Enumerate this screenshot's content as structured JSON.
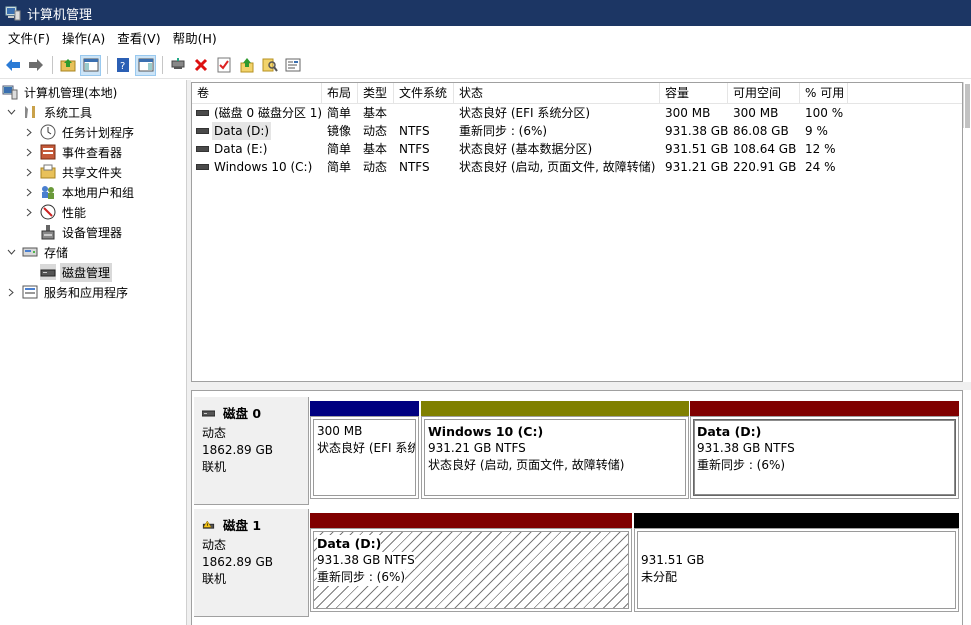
{
  "window": {
    "title": "计算机管理"
  },
  "menu": [
    "文件(F)",
    "操作(A)",
    "查看(V)",
    "帮助(H)"
  ],
  "toolbar": {
    "buttons": [
      "back-icon",
      "forward-icon",
      "up-folder-icon",
      "show-hide-tree-icon",
      "help-icon",
      "action-pane-icon",
      "connect-icon",
      "delete-icon",
      "properties-icon",
      "export-icon",
      "find-icon",
      "settings-icon"
    ]
  },
  "tree": {
    "root": "计算机管理(本地)",
    "system_tools": "系统工具",
    "task_scheduler": "任务计划程序",
    "event_viewer": "事件查看器",
    "shared_folders": "共享文件夹",
    "local_users": "本地用户和组",
    "performance": "性能",
    "device_manager": "设备管理器",
    "storage": "存储",
    "disk_management": "磁盘管理",
    "services": "服务和应用程序"
  },
  "volumes": {
    "headers": [
      "卷",
      "布局",
      "类型",
      "文件系统",
      "状态",
      "容量",
      "可用空间",
      "% 可用"
    ],
    "rows": [
      [
        "(磁盘 0 磁盘分区 1)",
        "简单",
        "基本",
        "",
        "状态良好 (EFI 系统分区)",
        "300 MB",
        "300 MB",
        "100 %"
      ],
      [
        "Data (D:)",
        "镜像",
        "动态",
        "NTFS",
        "重新同步 : (6%)",
        "931.38 GB",
        "86.08 GB",
        "9 %"
      ],
      [
        "Data (E:)",
        "简单",
        "基本",
        "NTFS",
        "状态良好 (基本数据分区)",
        "931.51 GB",
        "108.64 GB",
        "12 %"
      ],
      [
        "Windows 10 (C:)",
        "简单",
        "动态",
        "NTFS",
        "状态良好 (启动, 页面文件, 故障转储)",
        "931.21 GB",
        "220.91 GB",
        "24 %"
      ]
    ]
  },
  "disks": [
    {
      "name": "磁盘 0",
      "type": "动态",
      "size": "1862.89 GB",
      "status": "联机",
      "partitions": [
        {
          "name": "",
          "size": "300 MB",
          "status": "状态良好 (EFI 系统",
          "color": "#000080"
        },
        {
          "name": "Windows 10  (C:)",
          "size": "931.21 GB NTFS",
          "status": "状态良好 (启动, 页面文件, 故障转储)",
          "color": "#808000"
        },
        {
          "name": "Data  (D:)",
          "size": "931.38 GB NTFS",
          "status": "重新同步 : (6%)",
          "color": "#800000"
        }
      ]
    },
    {
      "name": "磁盘 1",
      "type": "动态",
      "size": "1862.89 GB",
      "status": "联机",
      "partitions": [
        {
          "name": "Data  (D:)",
          "size": "931.38 GB NTFS",
          "status": "重新同步 : (6%)",
          "color": "#800000"
        },
        {
          "name": "",
          "size": "931.51 GB",
          "status": "未分配",
          "color": "#000000"
        }
      ]
    }
  ]
}
